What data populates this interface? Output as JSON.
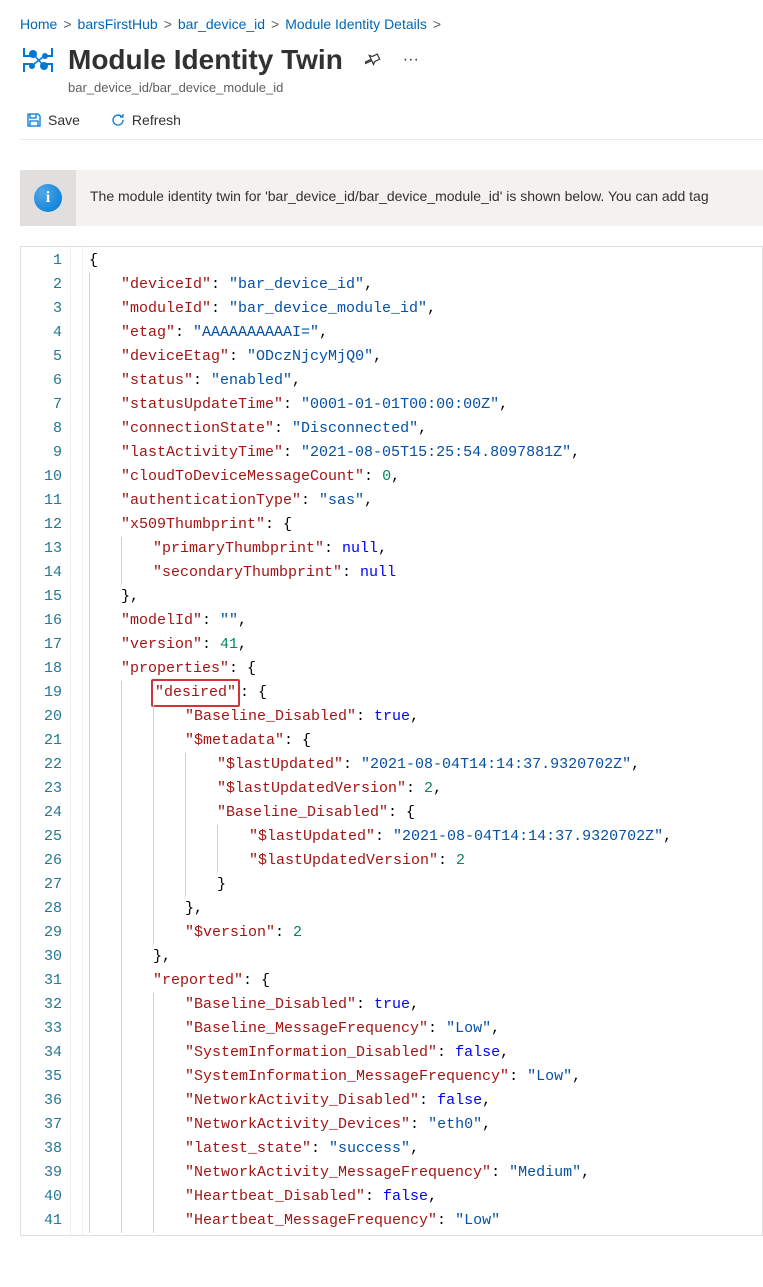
{
  "breadcrumb": {
    "items": [
      "Home",
      "barsFirstHub",
      "bar_device_id",
      "Module Identity Details"
    ],
    "chevron": ">"
  },
  "title": {
    "heading": "Module Identity Twin",
    "subtitle": "bar_device_id/bar_device_module_id"
  },
  "toolbar": {
    "save_label": "Save",
    "refresh_label": "Refresh"
  },
  "info": {
    "text": "The module identity twin for 'bar_device_id/bar_device_module_id' is shown below. You can add tag"
  },
  "editor": {
    "line_count": 41,
    "highlighted_key": "desired",
    "json": {
      "deviceId": "bar_device_id",
      "moduleId": "bar_device_module_id",
      "etag": "AAAAAAAAAAI=",
      "deviceEtag": "ODczNjcyMjQ0",
      "status": "enabled",
      "statusUpdateTime": "0001-01-01T00:00:00Z",
      "connectionState": "Disconnected",
      "lastActivityTime": "2021-08-05T15:25:54.8097881Z",
      "cloudToDeviceMessageCount": 0,
      "authenticationType": "sas",
      "x509Thumbprint": {
        "primaryThumbprint": null,
        "secondaryThumbprint": null
      },
      "modelId": "",
      "version": 41,
      "properties": {
        "desired": {
          "Baseline_Disabled": true,
          "$metadata": {
            "$lastUpdated": "2021-08-04T14:14:37.9320702Z",
            "$lastUpdatedVersion": 2,
            "Baseline_Disabled": {
              "$lastUpdated": "2021-08-04T14:14:37.9320702Z",
              "$lastUpdatedVersion": 2
            }
          },
          "$version": 2
        },
        "reported": {
          "Baseline_Disabled": true,
          "Baseline_MessageFrequency": "Low",
          "SystemInformation_Disabled": false,
          "SystemInformation_MessageFrequency": "Low",
          "NetworkActivity_Disabled": false,
          "NetworkActivity_Devices": "eth0",
          "latest_state": "success",
          "NetworkActivity_MessageFrequency": "Medium",
          "Heartbeat_Disabled": false,
          "Heartbeat_MessageFrequency": "Low"
        }
      }
    }
  }
}
